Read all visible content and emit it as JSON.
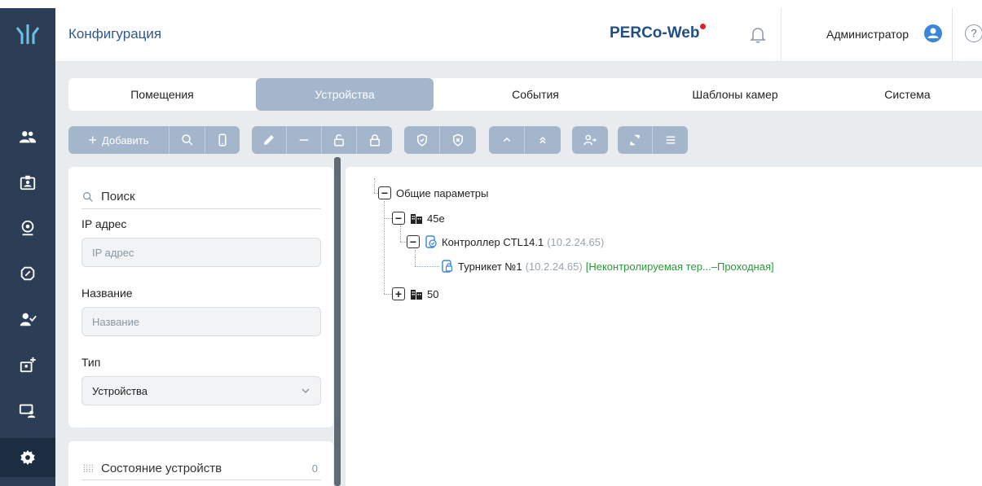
{
  "header": {
    "title": "Конфигурация",
    "brand": "PERCo-Web",
    "user": "Администратор",
    "help": "?"
  },
  "tabs": [
    {
      "label": "Помещения",
      "active": false
    },
    {
      "label": "Устройства",
      "active": true
    },
    {
      "label": "События",
      "active": false
    },
    {
      "label": "Шаблоны камер",
      "active": false
    },
    {
      "label": "Система",
      "active": false
    }
  ],
  "toolbar": {
    "add_label": "Добавить"
  },
  "filters": {
    "search_label": "Поиск",
    "ip_label": "IP адрес",
    "ip_placeholder": "IP адрес",
    "name_label": "Название",
    "name_placeholder": "Название",
    "type_label": "Тип",
    "type_value": "Устройства"
  },
  "device_state": {
    "label": "Состояние устройств",
    "count": "0"
  },
  "tree": {
    "root": "Общие параметры",
    "building_1": "45е",
    "controller_name": "Контроллер CTL14.1",
    "controller_ip": "(10.2.24.65)",
    "turnstile_name": "Турникет №1",
    "turnstile_ip": "(10.2.24.65)",
    "turnstile_zone": "[Неконтролируемая тер...–Проходная]",
    "building_2": "50"
  },
  "colors": {
    "sidebar": "#2c3e56",
    "accent": "#a3b6cc",
    "brand": "#1f4f86",
    "zone_green": "#2a9a3a"
  }
}
